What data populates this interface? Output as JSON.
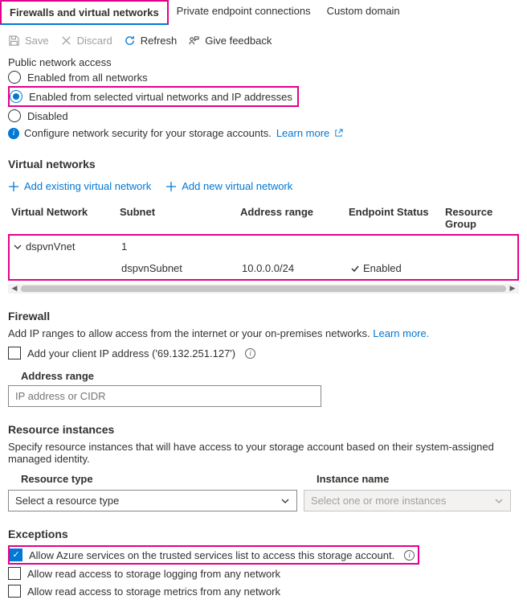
{
  "tabs": {
    "firewalls": "Firewalls and virtual networks",
    "private": "Private endpoint connections",
    "custom": "Custom domain"
  },
  "toolbar": {
    "save": "Save",
    "discard": "Discard",
    "refresh": "Refresh",
    "feedback": "Give feedback"
  },
  "publicAccess": {
    "title": "Public network access",
    "opt_all": "Enabled from all networks",
    "opt_selected": "Enabled from selected virtual networks and IP addresses",
    "opt_disabled": "Disabled",
    "info": "Configure network security for your storage accounts.",
    "learn": "Learn more"
  },
  "vnets": {
    "title": "Virtual networks",
    "add_existing": "Add existing virtual network",
    "add_new": "Add new virtual network",
    "cols": {
      "vn": "Virtual Network",
      "sub": "Subnet",
      "addr": "Address range",
      "ep": "Endpoint Status",
      "rg": "Resource Group"
    },
    "row1": {
      "name": "dspvnVnet",
      "count": "1"
    },
    "row2": {
      "subnet": "dspvnSubnet",
      "addr": "10.0.0.0/24",
      "status": "Enabled"
    }
  },
  "firewall": {
    "title": "Firewall",
    "desc": "Add IP ranges to allow access from the internet or your on-premises networks.",
    "learn": "Learn more.",
    "add_client": "Add your client IP address ('69.132.251.127')",
    "addr_label": "Address range",
    "placeholder": "IP address or CIDR"
  },
  "resourceInstances": {
    "title": "Resource instances",
    "desc": "Specify resource instances that will have access to your storage account based on their system-assigned managed identity.",
    "col_type": "Resource type",
    "col_name": "Instance name",
    "sel_type_ph": "Select a resource type",
    "sel_name_ph": "Select one or more instances"
  },
  "exceptions": {
    "title": "Exceptions",
    "ex1": "Allow Azure services on the trusted services list to access this storage account.",
    "ex2": "Allow read access to storage logging from any network",
    "ex3": "Allow read access to storage metrics from any network"
  }
}
